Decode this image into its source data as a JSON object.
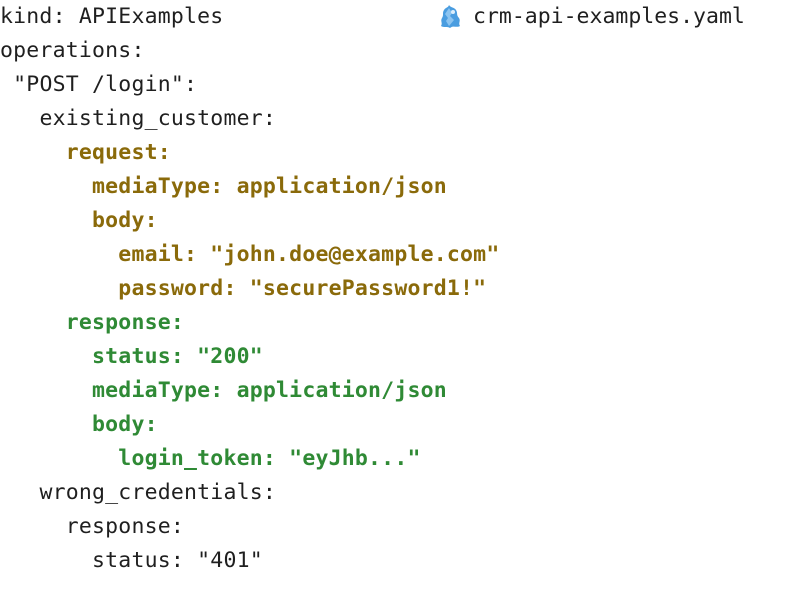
{
  "editor": {
    "file_icon": "stoplight-yaml-file-icon",
    "file_name": "crm-api-examples.yaml",
    "lines": [
      {
        "indent": "",
        "text": "kind: APIExamples",
        "kind": "plain"
      },
      {
        "indent": "",
        "text": "operations:",
        "kind": "plain"
      },
      {
        "indent": " ",
        "text": "\"POST /login\":",
        "kind": "plain"
      },
      {
        "indent": "   ",
        "text": "existing_customer:",
        "kind": "plain"
      },
      {
        "indent": "     ",
        "text": "request:",
        "kind": "req"
      },
      {
        "indent": "       ",
        "text": "mediaType: application/json",
        "kind": "req"
      },
      {
        "indent": "       ",
        "text": "body:",
        "kind": "req"
      },
      {
        "indent": "         ",
        "text": "email: \"john.doe@example.com\"",
        "kind": "req"
      },
      {
        "indent": "         ",
        "text": "password: \"securePassword1!\"",
        "kind": "req"
      },
      {
        "indent": "     ",
        "text": "response:",
        "kind": "res"
      },
      {
        "indent": "       ",
        "text": "status: \"200\"",
        "kind": "res"
      },
      {
        "indent": "       ",
        "text": "mediaType: application/json",
        "kind": "res"
      },
      {
        "indent": "       ",
        "text": "body:",
        "kind": "res"
      },
      {
        "indent": "         ",
        "text": "login_token: \"eyJhb...\"",
        "kind": "res"
      },
      {
        "indent": "   ",
        "text": "wrong_credentials:",
        "kind": "plain"
      },
      {
        "indent": "     ",
        "text": "response:",
        "kind": "plain"
      },
      {
        "indent": "       ",
        "text": "status: \"401\"",
        "kind": "plain"
      }
    ]
  },
  "colors": {
    "request_highlight": "#8a6a0a",
    "response_highlight": "#2f8a35",
    "default_text": "#1f1f1f",
    "icon_blue": "#4a9de0"
  }
}
